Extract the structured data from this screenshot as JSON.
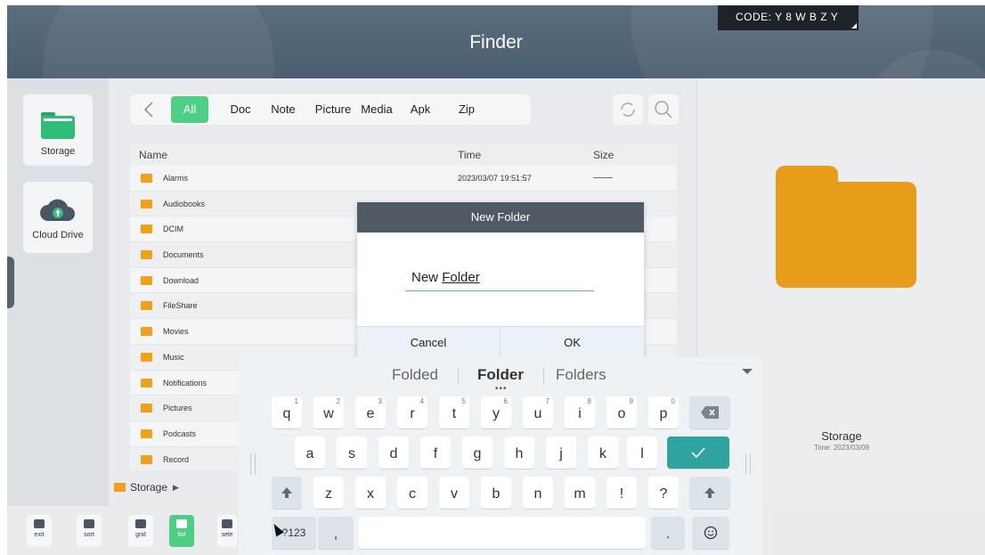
{
  "header": {
    "title": "Finder",
    "code": "CODE: Y 8 W B Z Y"
  },
  "sidebar": {
    "items": [
      {
        "label": "Storage"
      },
      {
        "label": "Cloud Drive"
      }
    ]
  },
  "tabs": [
    "All",
    "Doc",
    "Note",
    "Picture",
    "Media",
    "Apk",
    "Zip"
  ],
  "list": {
    "columns": {
      "name": "Name",
      "time": "Time",
      "size": "Size"
    },
    "rows": [
      {
        "name": "Alarms",
        "time": "2023/03/07 19:51:57"
      },
      {
        "name": "Audiobooks",
        "time": ""
      },
      {
        "name": "DCIM",
        "time": ""
      },
      {
        "name": "Documents",
        "time": ""
      },
      {
        "name": "Download",
        "time": ""
      },
      {
        "name": "FileShare",
        "time": ""
      },
      {
        "name": "Movies",
        "time": ""
      },
      {
        "name": "Music",
        "time": ""
      },
      {
        "name": "Notifications",
        "time": ""
      },
      {
        "name": "Pictures",
        "time": ""
      },
      {
        "name": "Podcasts",
        "time": ""
      },
      {
        "name": "Record",
        "time": ""
      }
    ]
  },
  "breadcrumb": {
    "label": "Storage"
  },
  "detail": {
    "title": "Storage",
    "time": "Time: 2023/03/09"
  },
  "toolbar": {
    "exit": "exit",
    "sort": "sort",
    "grid": "grid",
    "list": "list",
    "select": "sele"
  },
  "dialog": {
    "title": "New Folder",
    "value_prefix": "New ",
    "value_underlined": "Folder",
    "cancel": "Cancel",
    "ok": "OK"
  },
  "keyboard": {
    "suggestions": [
      "Folded",
      "Folder",
      "Folders"
    ],
    "row1": [
      "q",
      "w",
      "e",
      "r",
      "t",
      "y",
      "u",
      "i",
      "o",
      "p"
    ],
    "row1_hints": [
      "1",
      "2",
      "3",
      "4",
      "5",
      "6",
      "7",
      "8",
      "9",
      "0"
    ],
    "row2": [
      "a",
      "s",
      "d",
      "f",
      "g",
      "h",
      "j",
      "k",
      "l"
    ],
    "row3": [
      "z",
      "x",
      "c",
      "v",
      "b",
      "n",
      "m",
      "!",
      "?"
    ],
    "sym": "?123",
    "comma": ",",
    "period": "."
  },
  "colors": {
    "accent": "#4fcf86",
    "folder": "#f0a11a",
    "enter_key": "#2fa3a0",
    "header": "#52657a"
  }
}
